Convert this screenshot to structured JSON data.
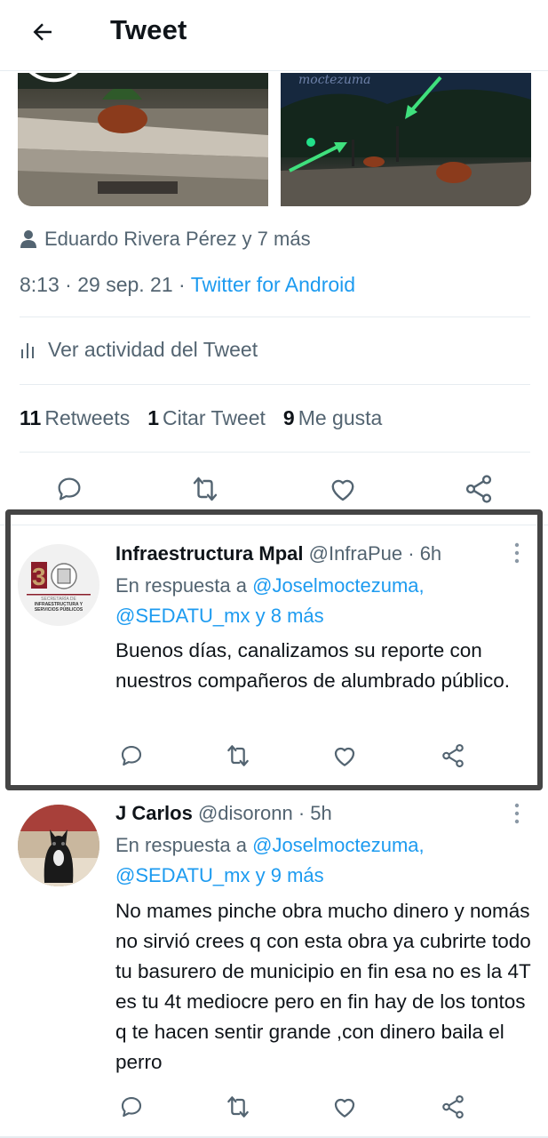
{
  "header": {
    "title": "Tweet",
    "back_icon": "arrow-left-icon"
  },
  "media": {
    "watermark": "moctezuma"
  },
  "tweet": {
    "likers": "Eduardo Rivera Pérez y 7 más",
    "time": "8:13",
    "date": "29 sep. 21",
    "separator": "·",
    "source": "Twitter for Android",
    "activity_label": "Ver actividad del Tweet",
    "stats": [
      {
        "count": "11",
        "label": "Retweets"
      },
      {
        "count": "1",
        "label": "Citar Tweet"
      },
      {
        "count": "9",
        "label": "Me gusta"
      }
    ]
  },
  "replies": [
    {
      "name": "Infraestructura Mpal",
      "handle": "@InfraPue",
      "age": "· 6h",
      "reply_prefix": "En respuesta a",
      "mention_line1": "@Joselmoctezuma,",
      "mention_line2": "@SEDATU_mx y 8 más",
      "text": "Buenos días, canalizamos su reporte con nuestros compañeros de alumbrado público.",
      "avatar_text": "SECRETARÍA DE INFRAESTRUCTURA Y SERVICIOS PÚBLICOS",
      "avatar_number": "3"
    },
    {
      "name": "J Carlos",
      "handle": "@disoronn",
      "age": "· 5h",
      "reply_prefix": "En respuesta a",
      "mention_line1": "@Joselmoctezuma,",
      "mention_line2": "@SEDATU_mx y 9 más",
      "text": "No mames pinche obra mucho dinero y nomás no sirvió crees q con esta obra ya cubrirte todo tu basurero de municipio en fin esa no es la 4T es tu 4t mediocre pero en fin hay de los tontos q te hacen sentir grande ,con dinero baila el perro"
    }
  ],
  "colors": {
    "accent": "#1d9bf0",
    "text": "#0f1419",
    "muted": "#536471",
    "border": "#e6ecf0",
    "highlight": "#454545"
  }
}
